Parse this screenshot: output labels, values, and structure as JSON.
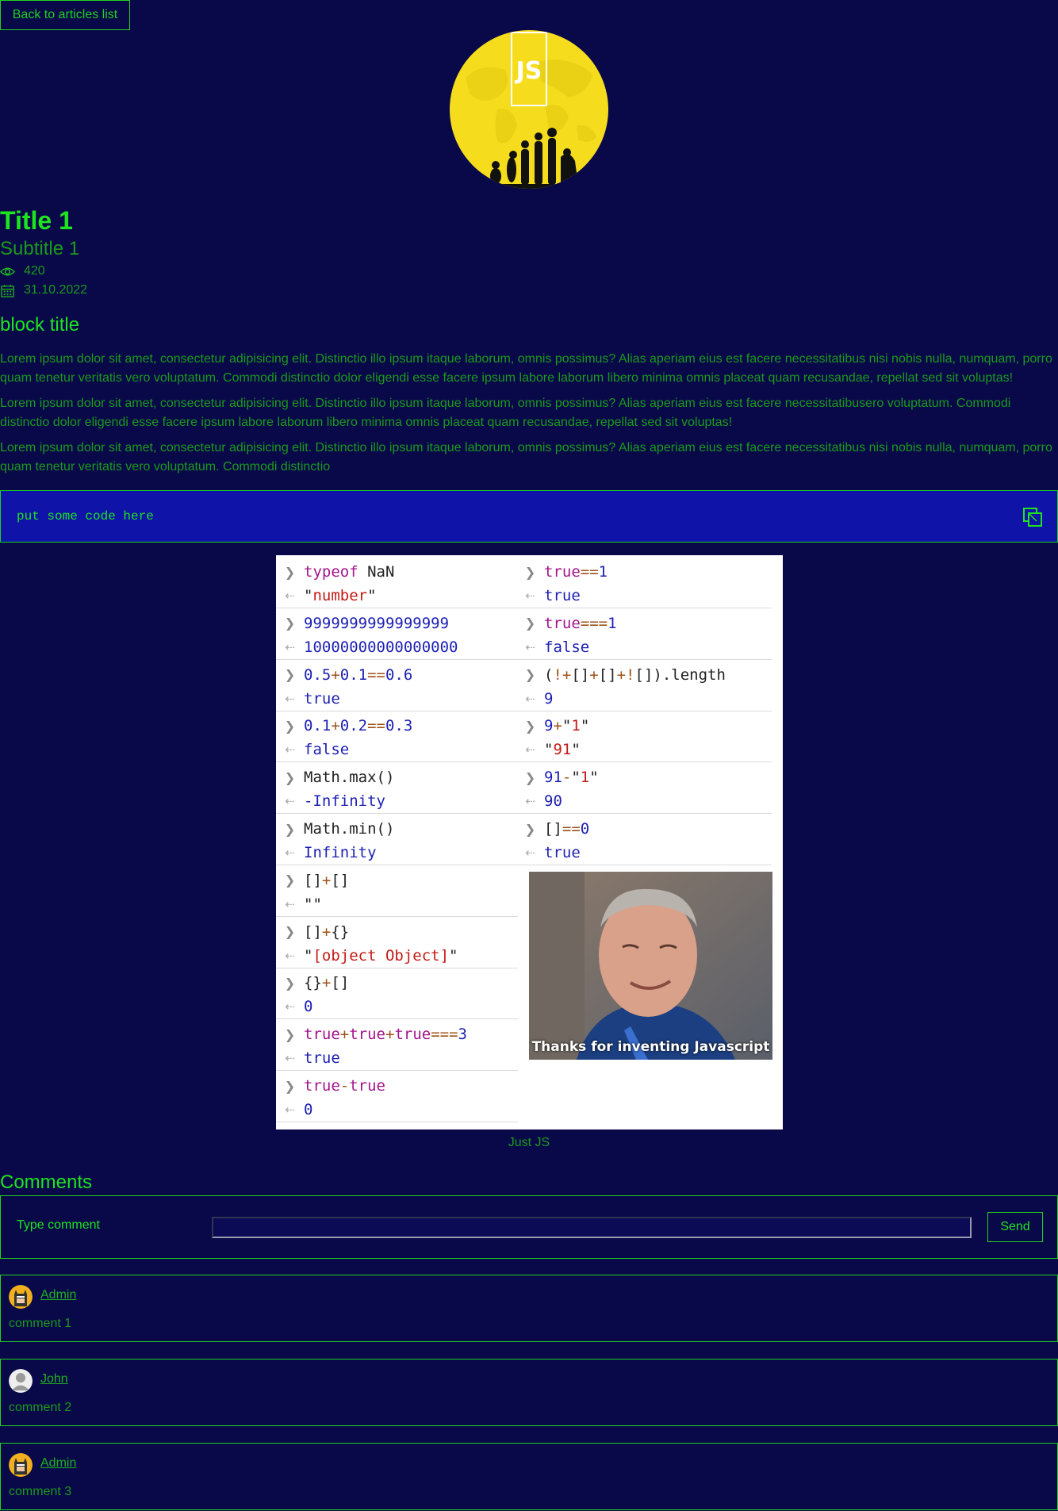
{
  "nav": {
    "back_label": "Back to articles list"
  },
  "article": {
    "logo_text": "JS",
    "title": "Title 1",
    "subtitle": "Subtitle 1",
    "views": "420",
    "date": "31.10.2022",
    "block_title": "block title",
    "paragraphs": [
      "Lorem ipsum dolor sit amet, consectetur adipisicing elit. Distinctio illo ipsum itaque laborum, omnis possimus? Alias aperiam eius est facere necessitatibus nisi nobis nulla, numquam, porro quam tenetur veritatis vero voluptatum. Commodi distinctio dolor eligendi esse facere ipsum labore laborum libero minima omnis placeat quam recusandae, repellat sed sit voluptas!",
      "Lorem ipsum dolor sit amet, consectetur adipisicing elit. Distinctio illo ipsum itaque laborum, omnis possimus? Alias aperiam eius est facere necessitatibusero voluptatum. Commodi distinctio dolor eligendi esse facere ipsum labore laborum libero minima omnis placeat quam recusandae, repellat sed sit voluptas!",
      "Lorem ipsum dolor sit amet, consectetur adipisicing elit. Distinctio illo ipsum itaque laborum, omnis possimus? Alias aperiam eius est facere necessitatibus nisi nobis nulla, numquam, porro quam tenetur veritatis vero voluptatum. Commodi distinctio"
    ],
    "code": "put some code here",
    "image_caption_in_photo": "Thanks for inventing Javascript",
    "figure_caption": "Just JS"
  },
  "meme": {
    "left": [
      [
        "typeof NaN",
        "\"number\""
      ],
      [
        "9999999999999999",
        "10000000000000000"
      ],
      [
        "0.5+0.1==0.6",
        "true"
      ],
      [
        "0.1+0.2==0.3",
        "false"
      ],
      [
        "Math.max()",
        "-Infinity"
      ],
      [
        "Math.min()",
        "Infinity"
      ],
      [
        "[]+[]",
        "\"\""
      ],
      [
        "[]+{}",
        "\"[object Object]\""
      ],
      [
        "{}+[]",
        "0"
      ],
      [
        "true+true+true===3",
        "true"
      ],
      [
        "true-true",
        "0"
      ]
    ],
    "right": [
      [
        "true==1",
        "true"
      ],
      [
        "true===1",
        "false"
      ],
      [
        "(!+[]+[]+![]).length",
        "9"
      ],
      [
        "9+\"1\"",
        "\"91\""
      ],
      [
        "91-\"1\"",
        "90"
      ],
      [
        "[]==0",
        "true"
      ]
    ]
  },
  "comments": {
    "title": "Comments",
    "form_label": "Type comment",
    "input_value": "",
    "send_label": "Send",
    "items": [
      {
        "author": "Admin",
        "avatar": "batman-avatar",
        "text": "comment 1"
      },
      {
        "author": "John",
        "avatar": "default-user-avatar",
        "text": "comment 2"
      },
      {
        "author": "Admin",
        "avatar": "batman-avatar",
        "text": "comment 3"
      }
    ]
  },
  "colors": {
    "background": "#090949",
    "accent_green": "#1ee41e",
    "code_block_bg": "#0f13a7",
    "logo_yellow": "#f5dd1e"
  }
}
